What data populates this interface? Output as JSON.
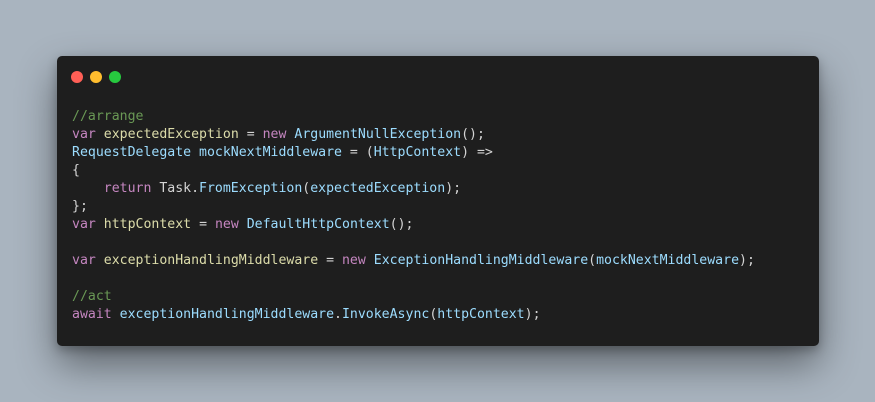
{
  "window": {
    "dots": [
      {
        "name": "close-dot",
        "color": "#ff5f56"
      },
      {
        "name": "minimize-dot",
        "color": "#ffbd2e"
      },
      {
        "name": "maximize-dot",
        "color": "#27c93f"
      }
    ]
  },
  "code": {
    "lines": [
      [
        {
          "t": "//arrange",
          "c": "comment"
        }
      ],
      [
        {
          "t": "var",
          "c": "keyword"
        },
        {
          "t": " ",
          "c": "punct"
        },
        {
          "t": "expectedException",
          "c": "variable"
        },
        {
          "t": " = ",
          "c": "punct"
        },
        {
          "t": "new",
          "c": "keyword"
        },
        {
          "t": " ",
          "c": "punct"
        },
        {
          "t": "ArgumentNullException",
          "c": "type"
        },
        {
          "t": "();",
          "c": "punct"
        }
      ],
      [
        {
          "t": "RequestDelegate",
          "c": "type"
        },
        {
          "t": " ",
          "c": "punct"
        },
        {
          "t": "mockNextMiddleware",
          "c": "type"
        },
        {
          "t": " = (",
          "c": "punct"
        },
        {
          "t": "HttpContext",
          "c": "type"
        },
        {
          "t": ") =>",
          "c": "punct"
        }
      ],
      [
        {
          "t": "{",
          "c": "punct"
        }
      ],
      [
        {
          "t": "    ",
          "c": "punct"
        },
        {
          "t": "return",
          "c": "keyword"
        },
        {
          "t": " Task.",
          "c": "ident"
        },
        {
          "t": "FromException",
          "c": "func"
        },
        {
          "t": "(",
          "c": "punct"
        },
        {
          "t": "expectedException",
          "c": "param"
        },
        {
          "t": ");",
          "c": "punct"
        }
      ],
      [
        {
          "t": "};",
          "c": "punct"
        }
      ],
      [
        {
          "t": "var",
          "c": "keyword"
        },
        {
          "t": " ",
          "c": "punct"
        },
        {
          "t": "httpContext",
          "c": "variable"
        },
        {
          "t": " = ",
          "c": "punct"
        },
        {
          "t": "new",
          "c": "keyword"
        },
        {
          "t": " ",
          "c": "punct"
        },
        {
          "t": "DefaultHttpContext",
          "c": "type"
        },
        {
          "t": "();",
          "c": "punct"
        }
      ],
      [],
      [
        {
          "t": "var",
          "c": "keyword"
        },
        {
          "t": " ",
          "c": "punct"
        },
        {
          "t": "exceptionHandlingMiddleware",
          "c": "variable"
        },
        {
          "t": " = ",
          "c": "punct"
        },
        {
          "t": "new",
          "c": "keyword"
        },
        {
          "t": " ",
          "c": "punct"
        },
        {
          "t": "ExceptionHandlingMiddleware",
          "c": "type"
        },
        {
          "t": "(",
          "c": "punct"
        },
        {
          "t": "mockNextMiddleware",
          "c": "param"
        },
        {
          "t": ");",
          "c": "punct"
        }
      ],
      [],
      [
        {
          "t": "//act",
          "c": "comment"
        }
      ],
      [
        {
          "t": "await",
          "c": "keyword"
        },
        {
          "t": " ",
          "c": "punct"
        },
        {
          "t": "exceptionHandlingMiddleware",
          "c": "type"
        },
        {
          "t": ".",
          "c": "punct"
        },
        {
          "t": "InvokeAsync",
          "c": "func"
        },
        {
          "t": "(",
          "c": "punct"
        },
        {
          "t": "httpContext",
          "c": "param"
        },
        {
          "t": ");",
          "c": "punct"
        }
      ]
    ]
  }
}
